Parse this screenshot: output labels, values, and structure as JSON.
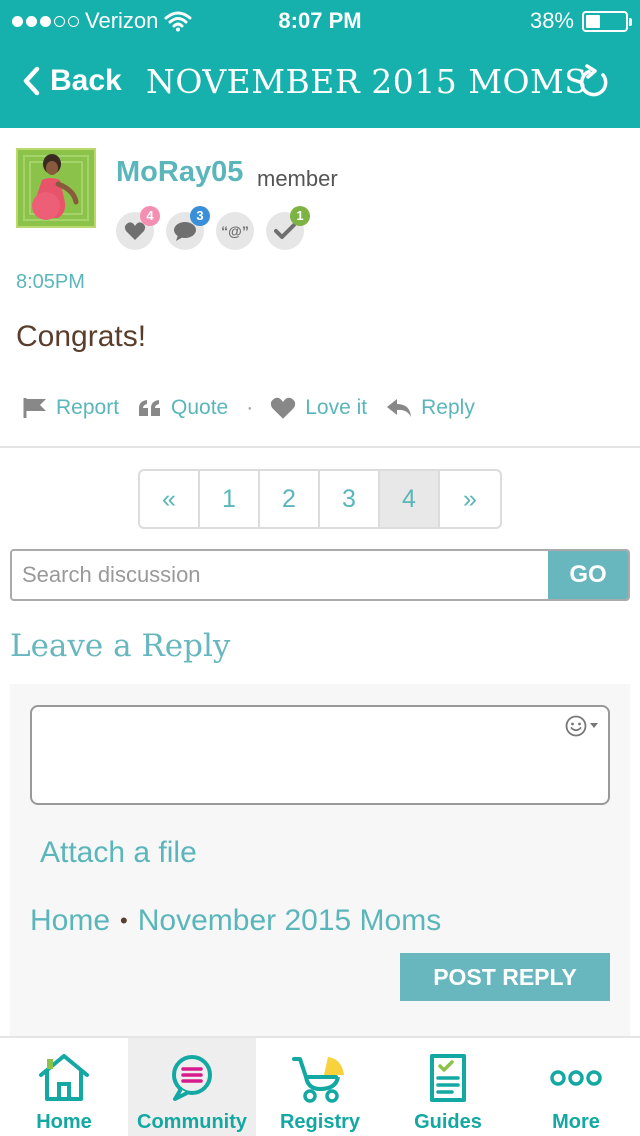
{
  "status_bar": {
    "carrier": "Verizon",
    "time": "8:07 PM",
    "battery": "38%",
    "battery_level": 0.38,
    "signal_bars_filled": 3,
    "signal_bars_total": 5
  },
  "nav": {
    "back_label": "Back",
    "title": "NOVEMBER 2015 MOMS",
    "refresh_icon": "refresh-icon"
  },
  "post": {
    "username": "MoRay05",
    "role": "member",
    "badges": [
      {
        "icon": "heart-icon",
        "count": "4",
        "color": "#f48fb1"
      },
      {
        "icon": "comment-icon",
        "count": "3",
        "color": "#3a8fd6"
      },
      {
        "icon": "mention-icon",
        "symbol": "“@”",
        "count": "",
        "color": ""
      },
      {
        "icon": "check-icon",
        "count": "1",
        "color": "#7cb342"
      }
    ],
    "time": "8:05PM",
    "body": "Congrats!",
    "actions": {
      "report": "Report",
      "quote": "Quote",
      "separator": "·",
      "love": "Love it",
      "reply": "Reply"
    }
  },
  "pagination": {
    "prev": "«",
    "pages": [
      "1",
      "2",
      "3",
      "4"
    ],
    "current": "4",
    "next": "»"
  },
  "search": {
    "placeholder": "Search discussion",
    "value": "",
    "button": "GO"
  },
  "reply": {
    "title": "Leave a Reply",
    "attach": "Attach a file",
    "breadcrumb_home": "Home",
    "breadcrumb_sep": "•",
    "breadcrumb_group": "November 2015 Moms",
    "submit": "POST REPLY"
  },
  "tabs": [
    {
      "label": "Home",
      "icon": "home-icon",
      "active": false
    },
    {
      "label": "Community",
      "icon": "community-icon",
      "active": true
    },
    {
      "label": "Registry",
      "icon": "stroller-icon",
      "active": false
    },
    {
      "label": "Guides",
      "icon": "guide-icon",
      "active": false
    },
    {
      "label": "More",
      "icon": "more-icon",
      "active": false
    }
  ],
  "colors": {
    "brand_teal": "#16b1ac",
    "link_teal": "#5ab6ba",
    "button_teal": "#68b7be"
  }
}
